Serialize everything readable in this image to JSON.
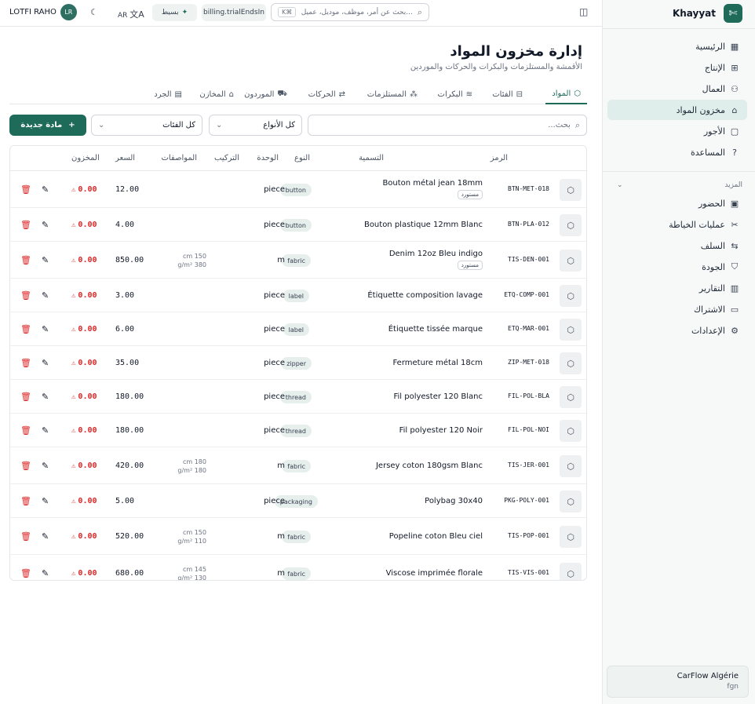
{
  "brand": {
    "name": "Khayyat",
    "logo_icon": "✄"
  },
  "nav": [
    {
      "label": "الرئيسية",
      "icon": "▦"
    },
    {
      "label": "الإنتاج",
      "icon": "⊞"
    },
    {
      "label": "العمال",
      "icon": "⚇"
    },
    {
      "label": "مخزون المواد",
      "icon": "⌂",
      "active": true
    },
    {
      "label": "الأجور",
      "icon": "▢"
    },
    {
      "label": "المساعدة",
      "icon": "?"
    }
  ],
  "nav_more_label": "المزيد",
  "nav_more": [
    {
      "label": "الحضور",
      "icon": "▣"
    },
    {
      "label": "عمليات الخياطة",
      "icon": "✂"
    },
    {
      "label": "السلف",
      "icon": "⇆"
    },
    {
      "label": "الجودة",
      "icon": "⛉"
    },
    {
      "label": "التقارير",
      "icon": "▥"
    },
    {
      "label": "الاشتراك",
      "icon": "▭"
    },
    {
      "label": "الإعدادات",
      "icon": "⚙"
    }
  ],
  "org": {
    "name": "CarFlow Algérie",
    "sub": "fgn"
  },
  "topbar": {
    "user_name": "LOTFI RAHO",
    "user_initials": "LR",
    "lang": "AR",
    "plan_label": "بسيط",
    "trial_label": "billing.trialEndsIn",
    "command_placeholder": "بحث عن أمر، موظف، موديل، عميل...",
    "command_kbd": "K⌘"
  },
  "page": {
    "title": "إدارة مخزون المواد",
    "subtitle": "الأقمشة والمستلزمات والبكرات والحركات والموردين"
  },
  "tabs": [
    {
      "label": "المواد",
      "icon": "⬡",
      "active": true
    },
    {
      "label": "الفئات",
      "icon": "⊟"
    },
    {
      "label": "البكرات",
      "icon": "≋"
    },
    {
      "label": "المستلزمات",
      "icon": "⁂"
    },
    {
      "label": "الحركات",
      "icon": "⇄"
    },
    {
      "label": "الموردون",
      "icon": "⛟"
    },
    {
      "label": "المخازن",
      "icon": "⌂"
    },
    {
      "label": "الجرد",
      "icon": "▤"
    }
  ],
  "filters": {
    "search_placeholder": "بحث...",
    "types_select": "كل الأنواع",
    "categories_select": "كل الفئات",
    "new_button": "مادة جديدة"
  },
  "table": {
    "headers": {
      "code": "الرمز",
      "name": "التسمية",
      "type": "النوع",
      "unit": "الوحدة",
      "composition": "التركيب",
      "specs": "المواصفات",
      "price": "السعر",
      "stock": "المخزون"
    },
    "imported_label": "مستورد",
    "rows": [
      {
        "code": "BTN-MET-018",
        "name": "Bouton métal jean 18mm",
        "imported": true,
        "type": "button",
        "unit": "piece",
        "specs1": "",
        "specs2": "",
        "price": "12.00",
        "stock": "0.00"
      },
      {
        "code": "BTN-PLA-012",
        "name": "Bouton plastique 12mm Blanc",
        "imported": false,
        "type": "button",
        "unit": "piece",
        "specs1": "",
        "specs2": "",
        "price": "4.00",
        "stock": "0.00"
      },
      {
        "code": "TIS-DEN-001",
        "name": "Denim 12oz Bleu indigo",
        "imported": true,
        "type": "fabric",
        "unit": "m",
        "specs1": "cm 150",
        "specs2": "g/m² 380",
        "price": "850.00",
        "stock": "0.00"
      },
      {
        "code": "ETQ-COMP-001",
        "name": "Étiquette composition lavage",
        "imported": false,
        "type": "label",
        "unit": "piece",
        "specs1": "",
        "specs2": "",
        "price": "3.00",
        "stock": "0.00"
      },
      {
        "code": "ETQ-MAR-001",
        "name": "Étiquette tissée marque",
        "imported": false,
        "type": "label",
        "unit": "piece",
        "specs1": "",
        "specs2": "",
        "price": "6.00",
        "stock": "0.00"
      },
      {
        "code": "ZIP-MET-018",
        "name": "Fermeture métal 18cm",
        "imported": false,
        "type": "zipper",
        "unit": "piece",
        "specs1": "",
        "specs2": "",
        "price": "35.00",
        "stock": "0.00"
      },
      {
        "code": "FIL-POL-BLA",
        "name": "Fil polyester 120 Blanc",
        "imported": false,
        "type": "thread",
        "unit": "piece",
        "specs1": "",
        "specs2": "",
        "price": "180.00",
        "stock": "0.00"
      },
      {
        "code": "FIL-POL-NOI",
        "name": "Fil polyester 120 Noir",
        "imported": false,
        "type": "thread",
        "unit": "piece",
        "specs1": "",
        "specs2": "",
        "price": "180.00",
        "stock": "0.00"
      },
      {
        "code": "TIS-JER-001",
        "name": "Jersey coton 180gsm Blanc",
        "imported": false,
        "type": "fabric",
        "unit": "m",
        "specs1": "cm 180",
        "specs2": "g/m² 180",
        "price": "420.00",
        "stock": "0.00"
      },
      {
        "code": "PKG-POLY-001",
        "name": "Polybag 30x40",
        "imported": false,
        "type": "packaging",
        "unit": "piece",
        "specs1": "",
        "specs2": "",
        "price": "5.00",
        "stock": "0.00"
      },
      {
        "code": "TIS-POP-001",
        "name": "Popeline coton Bleu ciel",
        "imported": false,
        "type": "fabric",
        "unit": "m",
        "specs1": "cm 150",
        "specs2": "g/m² 110",
        "price": "520.00",
        "stock": "0.00"
      },
      {
        "code": "TIS-VIS-001",
        "name": "Viscose imprimée florale",
        "imported": false,
        "type": "fabric",
        "unit": "m",
        "specs1": "cm 145",
        "specs2": "g/m² 130",
        "price": "680.00",
        "stock": "0.00"
      }
    ]
  },
  "colors": {
    "accent": "#1f6b5a",
    "danger": "#dc2626",
    "active_nav": "#dfeeea"
  }
}
